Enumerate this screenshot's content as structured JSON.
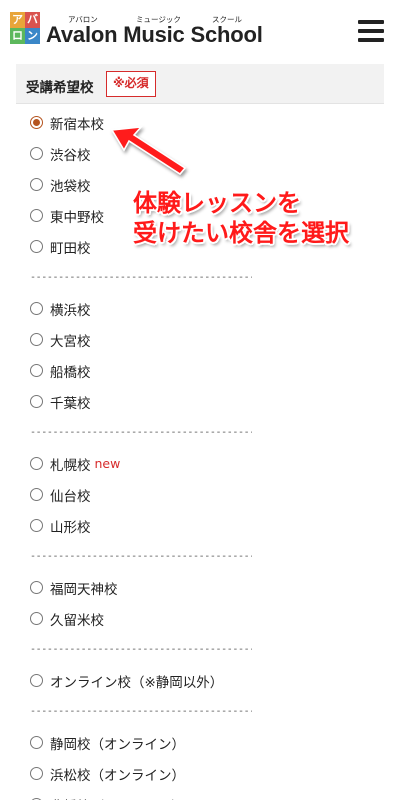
{
  "header": {
    "logo_chars": [
      "ア",
      "バ",
      "ロ",
      "ン"
    ],
    "ruby": [
      "アバロン",
      "ミュージック",
      "スクール"
    ],
    "brand": "Avalon Music School",
    "menu_icon": "hamburger-menu-icon"
  },
  "form": {
    "section_title": "受講希望校",
    "required_label": "※必須",
    "selected": "新宿本校",
    "groups": [
      [
        "新宿本校",
        "渋谷校",
        "池袋校",
        "東中野校",
        "町田校"
      ],
      [
        "横浜校",
        "大宮校",
        "船橋校",
        "千葉校"
      ],
      [
        "札幌校",
        "仙台校",
        "山形校"
      ],
      [
        "福岡天神校",
        "久留米校"
      ],
      [
        "オンライン校（※静岡以外）"
      ],
      [
        "静岡校（オンライン）",
        "浜松校（オンライン）",
        "豊橋校（オンライン）"
      ]
    ],
    "new_tag": "new",
    "separator": "-----------------------------------------------"
  },
  "annotation": {
    "line1": "体験レッスンを",
    "line2": "受けたい校舎を選択"
  },
  "colors": {
    "accent": "#b5541f",
    "required": "#d62b2b",
    "annotation": "#ff1a1a"
  }
}
